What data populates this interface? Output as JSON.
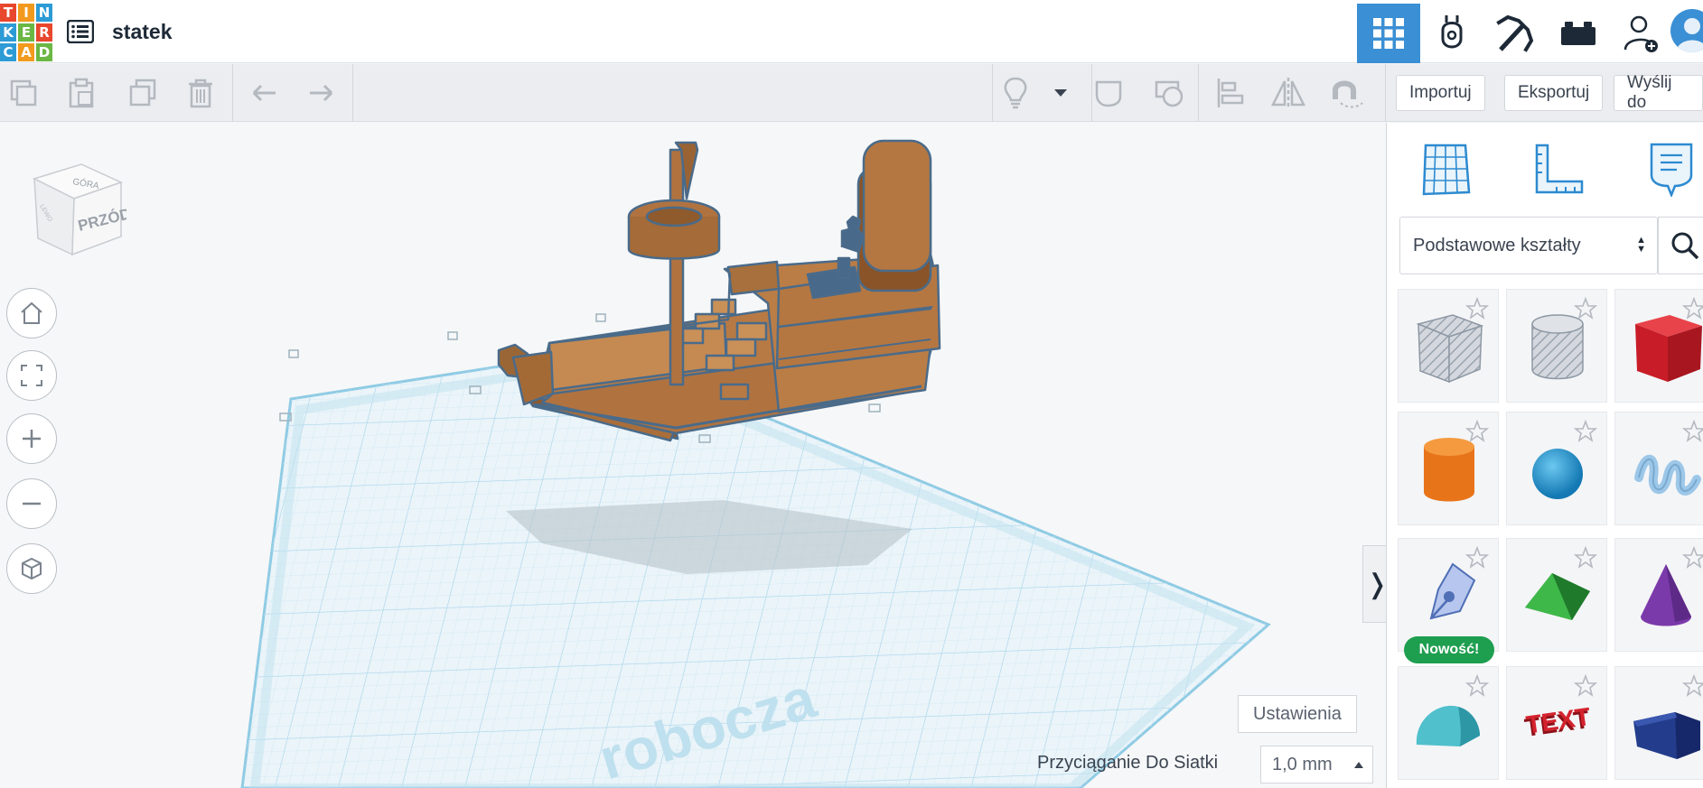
{
  "app": {
    "logo_letters": [
      "T",
      "I",
      "N",
      "K",
      "E",
      "R",
      "C",
      "A",
      "D"
    ],
    "project_title": "statek"
  },
  "top_nav": {
    "items": [
      {
        "name": "3D Design",
        "icon": "grid-icon",
        "active": true
      },
      {
        "name": "Circuits",
        "icon": "circuits-icon",
        "active": false
      },
      {
        "name": "Minecraft",
        "icon": "pickaxe-icon",
        "active": false
      },
      {
        "name": "Bricks",
        "icon": "brick-icon",
        "active": false
      },
      {
        "name": "Invite",
        "icon": "user-add-icon",
        "active": false
      }
    ],
    "accent_color": "#3b8fd4"
  },
  "toolbar": {
    "import_label": "Importuj",
    "export_label": "Eksportuj",
    "send_label": "Wyślij do",
    "tools": [
      "copy-icon",
      "paste-icon",
      "duplicate-icon",
      "delete-icon",
      "undo-icon",
      "redo-icon",
      "lightbulb-icon",
      "dropdown-icon",
      "note-icon",
      "group-icon",
      "align-icon",
      "mirror-icon",
      "magnet-icon"
    ]
  },
  "workplane": {
    "view_cube_top": "GÓRA",
    "view_cube_front": "PRZÓD",
    "view_cube_left": "LEWO",
    "watermark": "robocza",
    "settings_label": "Ustawienia",
    "snap_label": "Przyciąganie Do Siatki",
    "snap_value": "1,0 mm",
    "object_color": "#b87a44",
    "grid_color": "#bfe1f0"
  },
  "nav_controls": [
    "home-icon",
    "fit-icon",
    "zoom-in-icon",
    "zoom-out-icon",
    "perspective-icon"
  ],
  "panel": {
    "tabs": [
      "workplane-grid-icon",
      "ruler-icon",
      "notes-icon"
    ],
    "library_label": "Podstawowe kształty",
    "new_badge": "Nowość!",
    "shapes": [
      {
        "name": "box-hole",
        "color": "#c9ced6"
      },
      {
        "name": "cylinder-hole",
        "color": "#c9ced6"
      },
      {
        "name": "box",
        "color": "#d81e2a"
      },
      {
        "name": "cylinder",
        "color": "#ef7d1a"
      },
      {
        "name": "sphere",
        "color": "#1f98d4"
      },
      {
        "name": "scribble",
        "color": "#9ec6e6"
      },
      {
        "name": "shape-generator",
        "color": "#6d8fd8"
      },
      {
        "name": "roof",
        "color": "#2f9e3c"
      },
      {
        "name": "cone",
        "color": "#7a3aa8"
      },
      {
        "name": "round-roof",
        "color": "#45b9c6"
      },
      {
        "name": "text",
        "color": "#c81f2a"
      },
      {
        "name": "half-cylinder",
        "color": "#233d8c"
      }
    ]
  }
}
